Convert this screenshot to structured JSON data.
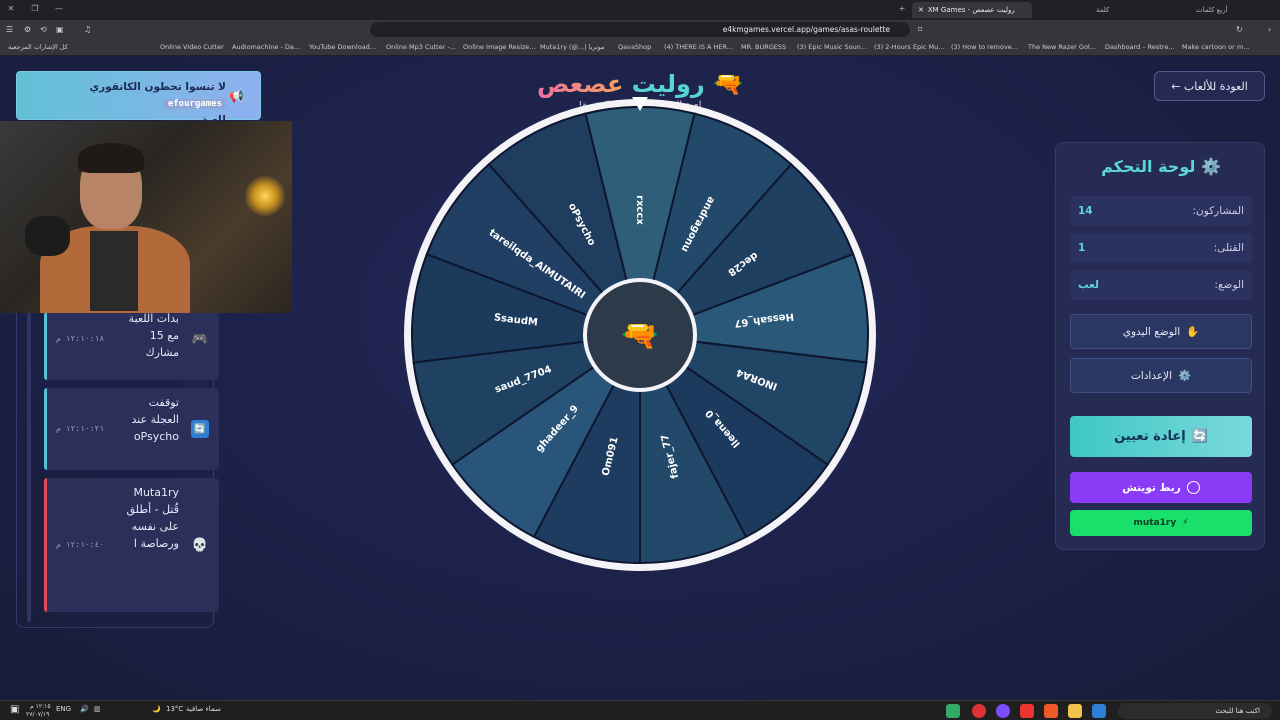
{
  "browser": {
    "tab_active": "XM Games - روليت عصعص",
    "tab_inactive": "كلمة",
    "tab_right": "أربع كلمات",
    "url": "e4kmgames.vercel.app/games/asas-roulette",
    "bookmarks_label": "كل الإشارات المرجعية",
    "bookmarks": [
      "Online Video Cutter",
      "Audiomachine - Da...",
      "YouTube Download...",
      "Online Mp3 Cutter -...",
      "Online Image Resize...",
      "Muta1ry (@...| موتريا",
      "QavaShop",
      "(4) THERE IS A HER...",
      "MR. BURGESS",
      "(3) Epic Music Soun...",
      "(3) 2-Hours Epic Mu...",
      "(3) How to remove...",
      "The New Razer Gol...",
      "Dashboard – Restre...",
      "Make cartoon or m..."
    ]
  },
  "announcement": {
    "text": "لا تنسوا تحطون الكاتقوري",
    "tag": "efourgames",
    "text2": "للعبة"
  },
  "header": {
    "title_part1": "روليت",
    "title_part2": "عصعص",
    "subtitle": "لعبة الروليت الروسية المثيرة!",
    "back_label": "العودة للألعاب ←"
  },
  "log": [
    {
      "text": "بدأت اللعبة مع 15 مشارك",
      "time": "١٢:١٠:١٨ م",
      "icon": "🎮",
      "bar": "#53c1d6"
    },
    {
      "text": "توقفت العجلة عند oPsycho",
      "time": "١٢:١٠:٢١ م",
      "icon": "🔄",
      "bar": "#53c1d6"
    },
    {
      "text": "Muta1ry قُتل - أطلق على نفسه ورصاصة ا",
      "time": "١٢:١٠:٤٠ م",
      "icon": "💀",
      "bar": "#e24a5a"
    }
  ],
  "wheel": {
    "names": [
      "rxccx",
      "andragonu",
      "dec28",
      "Hessah_67",
      "INORA4",
      "lleena_0",
      "fajer_77",
      "Om091",
      "ghadeer_9",
      "saud_7704",
      "SsaudM",
      "tareilqda_AlMUTAIRI",
      "oPsycho"
    ],
    "colors": [
      "#2e5e78",
      "#23496a",
      "#1f4060",
      "#2a5878",
      "#214565",
      "#1c3a5e",
      "#23496a",
      "#1d3c60",
      "#29557a",
      "#1f4262",
      "#1c3a5c",
      "#213f62",
      "#1e3d5f"
    ],
    "center_icon": "🔫"
  },
  "panel": {
    "title": "لوحة التحكم",
    "title_icon": "⚙️",
    "participants_label": "المشاركون:",
    "participants_value": "14",
    "killed_label": "القتلى:",
    "killed_value": "1",
    "mode_label": "الوضع:",
    "mode_value": "لعب",
    "manual_label": "الوضع اليدوي",
    "manual_icon": "✋",
    "settings_label": "الإعدادات",
    "settings_icon": "⚙️",
    "reset_label": "إعادة تعيين",
    "reset_icon": "🔄",
    "twitch_label": "ربط تويتش",
    "user_label": "muta1ry",
    "user_icon": "⚡"
  },
  "taskbar": {
    "time": "١٢:١٥ م",
    "date": "٢٧/٠٧/١٩",
    "lang": "ENG",
    "weather_temp": "13°C",
    "weather_text": "سماء صافية",
    "search_placeholder": "اكتب هنا للبحث"
  }
}
